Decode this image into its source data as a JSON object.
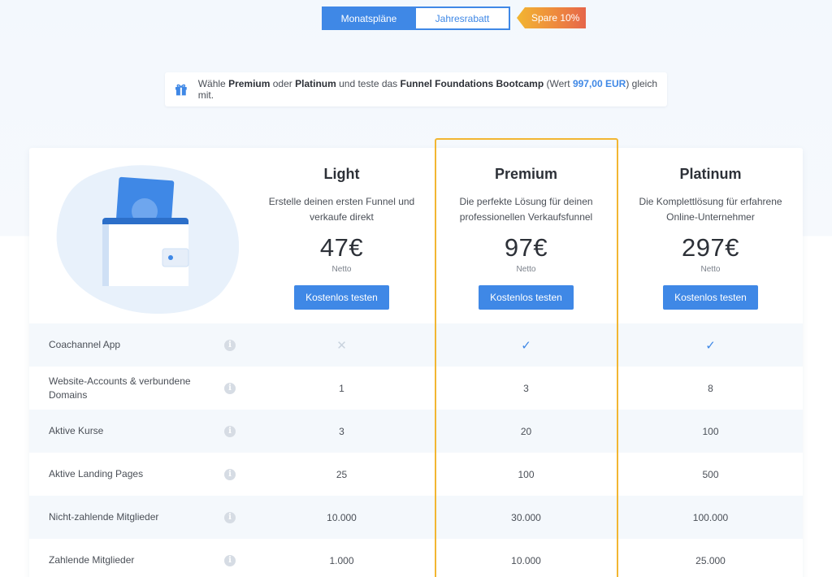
{
  "toggle": {
    "monthly": "Monatspläne",
    "yearly": "Jahresrabatt",
    "badge": "Spare 10%"
  },
  "promo": {
    "t1": "Wähle ",
    "b1": "Premium",
    "t2": " oder ",
    "b2": "Platinum",
    "t3": " und teste das ",
    "b3": "Funnel Foundations Bootcamp",
    "t4": " (Wert ",
    "amount": "997,00 EUR",
    "t5": ") gleich mit."
  },
  "plans": [
    {
      "name": "Light",
      "desc": "Erstelle deinen ersten Funnel und verkaufe direkt",
      "price": "47€",
      "netto": "Netto",
      "cta": "Kostenlos testen"
    },
    {
      "name": "Premium",
      "desc": "Die perfekte Lösung für deinen professionellen Verkaufsfunnel",
      "price": "97€",
      "netto": "Netto",
      "cta": "Kostenlos testen"
    },
    {
      "name": "Platinum",
      "desc": "Die Komplettlösung für erfahrene Online-Unternehmer",
      "price": "297€",
      "netto": "Netto",
      "cta": "Kostenlos testen"
    }
  ],
  "features": [
    {
      "label": "Coachannel App",
      "values": [
        "✕",
        "✓",
        "✓"
      ]
    },
    {
      "label": "Website-Accounts & verbundene Domains",
      "values": [
        "1",
        "3",
        "8"
      ]
    },
    {
      "label": "Aktive Kurse",
      "values": [
        "3",
        "20",
        "100"
      ]
    },
    {
      "label": "Aktive Landing Pages",
      "values": [
        "25",
        "100",
        "500"
      ]
    },
    {
      "label": "Nicht-zahlende Mitglieder",
      "values": [
        "10.000",
        "30.000",
        "100.000"
      ]
    },
    {
      "label": "Zahlende Mitglieder",
      "values": [
        "1.000",
        "10.000",
        "25.000"
      ]
    }
  ],
  "info_glyph": "i",
  "colors": {
    "accent": "#3f88e6",
    "highlight": "#f2b632",
    "badge_end": "#e6664a"
  }
}
